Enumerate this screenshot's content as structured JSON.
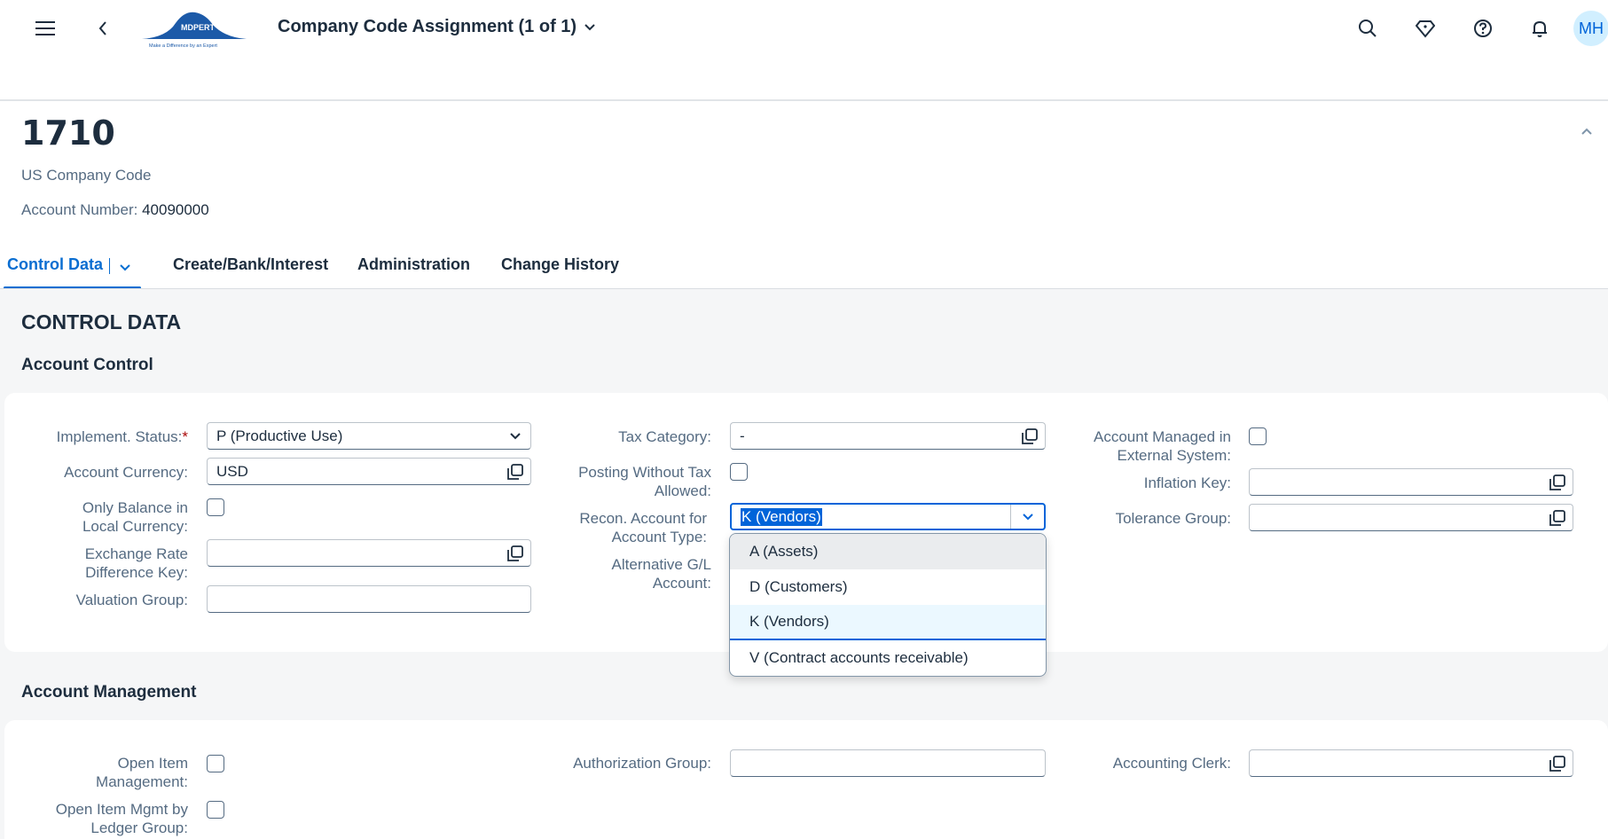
{
  "shell": {
    "app_title": "Company Code Assignment (1 of 1)",
    "logo": {
      "brand": "MDPERT",
      "tagline": "Make a Difference by an Expert"
    },
    "avatar_initials": "MH"
  },
  "header": {
    "title": "1710",
    "subtitle": "US Company Code",
    "account_number_label": "Account Number:",
    "account_number_value": "40090000"
  },
  "tabs": [
    {
      "label": "Control Data",
      "active": true
    },
    {
      "label": "Create/Bank/Interest"
    },
    {
      "label": "Administration"
    },
    {
      "label": "Change History"
    }
  ],
  "section_title": "CONTROL DATA",
  "account_control": {
    "title": "Account Control",
    "implement_status": {
      "label": "Implement. Status:",
      "required_mark": "*",
      "value": "P (Productive Use)"
    },
    "account_currency": {
      "label": "Account Currency:",
      "value": "USD"
    },
    "only_balance": {
      "label_line1": "Only Balance in",
      "label_line2": "Local Currency:",
      "checked": false
    },
    "exchange_rate": {
      "label_line1": "Exchange Rate",
      "label_line2": "Difference Key:",
      "value": ""
    },
    "valuation_group": {
      "label": "Valuation Group:",
      "value": ""
    },
    "tax_category": {
      "label": "Tax Category:",
      "value": "-"
    },
    "posting_without_tax": {
      "label_line1": "Posting Without Tax",
      "label_line2": "Allowed:",
      "checked": false
    },
    "recon_account": {
      "label_line1": "Recon. Account for",
      "label_line2": "Account Type:",
      "value": "K (Vendors)"
    },
    "alternative_gl": {
      "label_line1": "Alternative G/L",
      "label_line2": "Account:"
    },
    "account_managed": {
      "label_line1": "Account Managed in",
      "label_line2": "External System:",
      "checked": false
    },
    "inflation_key": {
      "label": "Inflation Key:",
      "value": ""
    },
    "tolerance_group": {
      "label": "Tolerance Group:",
      "value": ""
    }
  },
  "recon_dropdown": {
    "options": [
      "A (Assets)",
      "D (Customers)",
      "K (Vendors)",
      "V (Contract accounts receivable)"
    ],
    "selected": "K (Vendors)",
    "hovered": "A (Assets)"
  },
  "account_management": {
    "title": "Account Management",
    "open_item": {
      "label_line1": "Open Item",
      "label_line2": "Management:",
      "checked": false
    },
    "open_item_ledger": {
      "label_line1": "Open Item Mgmt by",
      "label_line2": "Ledger Group:",
      "checked": false
    },
    "authorization_group": {
      "label": "Authorization Group:",
      "value": ""
    },
    "accounting_clerk": {
      "label": "Accounting Clerk:",
      "value": ""
    }
  },
  "colors": {
    "accent": "#0a6ed1",
    "selection": "#0064d9",
    "label": "#556b82",
    "avatar_bg": "#d1efff"
  }
}
